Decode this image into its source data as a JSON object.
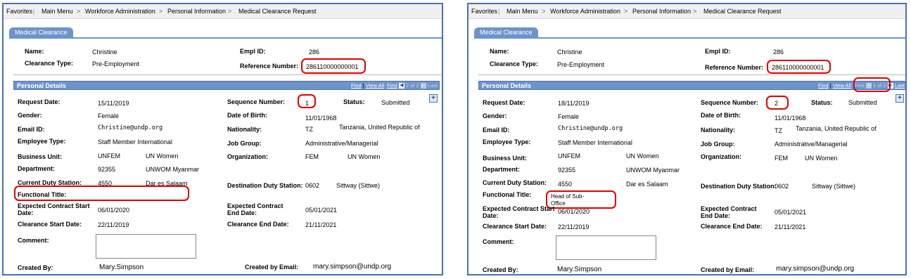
{
  "breadcrumb": [
    "Favorites",
    "Main Menu",
    "Workforce Administration",
    "Personal Information",
    "Medical Clearance Request"
  ],
  "breadcrumb_sep": ">",
  "tab_label": "Medical Clearance",
  "labels": {
    "name": "Name:",
    "clearance_type": "Clearance Type:",
    "empl_id": "Empl ID:",
    "reference_number": "Reference Number:",
    "section": "Personal Details",
    "request_date": "Request Date:",
    "sequence_number": "Sequence Number:",
    "status": "Status:",
    "gender": "Gender:",
    "date_of_birth": "Date of Birth:",
    "email_id": "Email ID:",
    "nationality": "Nationality:",
    "employee_type": "Employee Type:",
    "job_group": "Job Group:",
    "business_unit": "Business Unit:",
    "organization": "Organization:",
    "department": "Department:",
    "current_duty_station": "Current Duty Station:",
    "destination_duty_station": "Destination Duty Station:",
    "functional_title": "Functional Title:",
    "expected_contract_start": "Expected Contract Start Date:",
    "expected_contract_end": "Expected Contract End Date:",
    "clearance_start_date": "Clearance Start Date:",
    "clearance_end_date": "Clearance End Date:",
    "comment": "Comment:",
    "created_by": "Created By:",
    "created_by_email": "Created by Email:"
  },
  "grid_nav": {
    "find": "Find",
    "view_all": "View All",
    "first": "First",
    "last": "Last",
    "sep": "|"
  },
  "plus_icon": "+",
  "colors": {
    "accent": "#6d94c9",
    "frame": "#4a6fb5",
    "highlight": "#e00000"
  },
  "left": {
    "name": "Christine",
    "clearance_type": "Pre-Employment",
    "empl_id": "286",
    "reference_number": "286110000000001",
    "page_counter": "2 of 2",
    "request_date": "15/11/2019",
    "sequence_number": "1",
    "status": "Submitted",
    "gender": "Female",
    "date_of_birth": "11/01/1968",
    "email_id": "Christine@undp.org",
    "nationality_code": "TZ",
    "nationality_name": "Tanzania, United Republic of",
    "employee_type": "Staff Member International",
    "job_group": "Administrative/Managerial",
    "business_unit_code": "UNFEM",
    "business_unit_name": "UN Women",
    "organization_code": "FEM",
    "organization_name": "UN Women",
    "department_code": "92355",
    "department_name": "UNWOM Myanmar",
    "current_duty_code": "4550",
    "current_duty_name": "Dar es Salaam",
    "destination_duty_code": "0602",
    "destination_duty_name": "Sittway (Sittwe)",
    "functional_title": "",
    "expected_contract_start": "06/01/2020",
    "expected_contract_end": "05/01/2021",
    "clearance_start_date": "22/11/2019",
    "clearance_end_date": "21/11/2021",
    "created_by": "Mary.Simpson",
    "created_by_email": "mary.simpson@undp.org"
  },
  "right": {
    "name": "Christine",
    "clearance_type": "Pre-Employment",
    "empl_id": "286",
    "reference_number": "286110000000001",
    "page_counter": "1 of 2",
    "request_date": "18/11/2019",
    "sequence_number": "2",
    "status": "Submitted",
    "gender": "Female",
    "date_of_birth": "11/01/1968",
    "email_id": "Christine@undp.org",
    "nationality_code": "TZ",
    "nationality_name": "Tanzania, United Republic of",
    "employee_type": "Staff Member International",
    "job_group": "Administrative/Managerial",
    "business_unit_code": "UNFEM",
    "business_unit_name": "UN Women",
    "organization_code": "FEM",
    "organization_name": "UN Women",
    "department_code": "92355",
    "department_name": "UNWOM Myanmar",
    "current_duty_code": "4550",
    "current_duty_name": "Dar es Salaam",
    "destination_duty_code": "0602",
    "destination_duty_name": "Sittway (Sittwe)",
    "functional_title_line1": "Head of Sub-",
    "functional_title_line2": "Office",
    "expected_contract_start": "06/01/2020",
    "expected_contract_end": "05/01/2021",
    "clearance_start_date": "22/11/2019",
    "clearance_end_date": "21/11/2021",
    "created_by": "Mary.Simpson",
    "created_by_email": "mary.simpson@undp.org"
  }
}
